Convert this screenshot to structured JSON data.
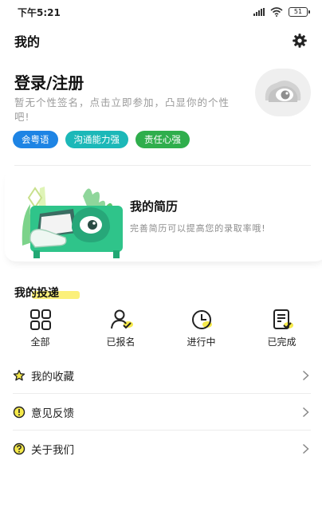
{
  "status_bar": {
    "time": "下午5:21",
    "battery": "51",
    "icons": [
      "signal-icon",
      "wifi-icon",
      "battery-icon"
    ]
  },
  "header": {
    "title": "我的",
    "settings_icon": "gear-icon"
  },
  "profile": {
    "login_label": "登录/注册",
    "signature_placeholder": "暂无个性签名，点击立即参加，凸显你的个性吧!",
    "tags": [
      {
        "label": "会粤语",
        "color": "#1e84e4"
      },
      {
        "label": "沟通能力强",
        "color": "#1cb8b8"
      },
      {
        "label": "责任心强",
        "color": "#2fae4c"
      }
    ],
    "avatar_icon": "eye-avatar-icon"
  },
  "resume_card": {
    "title": "我的简历",
    "subtitle": "完善简历可以提高您的录取率哦!"
  },
  "my_delivery": {
    "title": "我的投递",
    "items": [
      {
        "label": "全部",
        "icon": "grid-icon"
      },
      {
        "label": "已报名",
        "icon": "user-check-icon"
      },
      {
        "label": "进行中",
        "icon": "clock-icon"
      },
      {
        "label": "已完成",
        "icon": "document-check-icon"
      }
    ]
  },
  "menu": {
    "items": [
      {
        "label": "我的收藏",
        "icon": "star-icon"
      },
      {
        "label": "意见反馈",
        "icon": "exclamation-circle-icon"
      },
      {
        "label": "关于我们",
        "icon": "question-circle-icon"
      }
    ]
  },
  "colors": {
    "accent_highlight": "#fbf07a",
    "brand_green": "#2fc48a",
    "text_primary": "#111111",
    "text_secondary": "#9a9a9a"
  }
}
